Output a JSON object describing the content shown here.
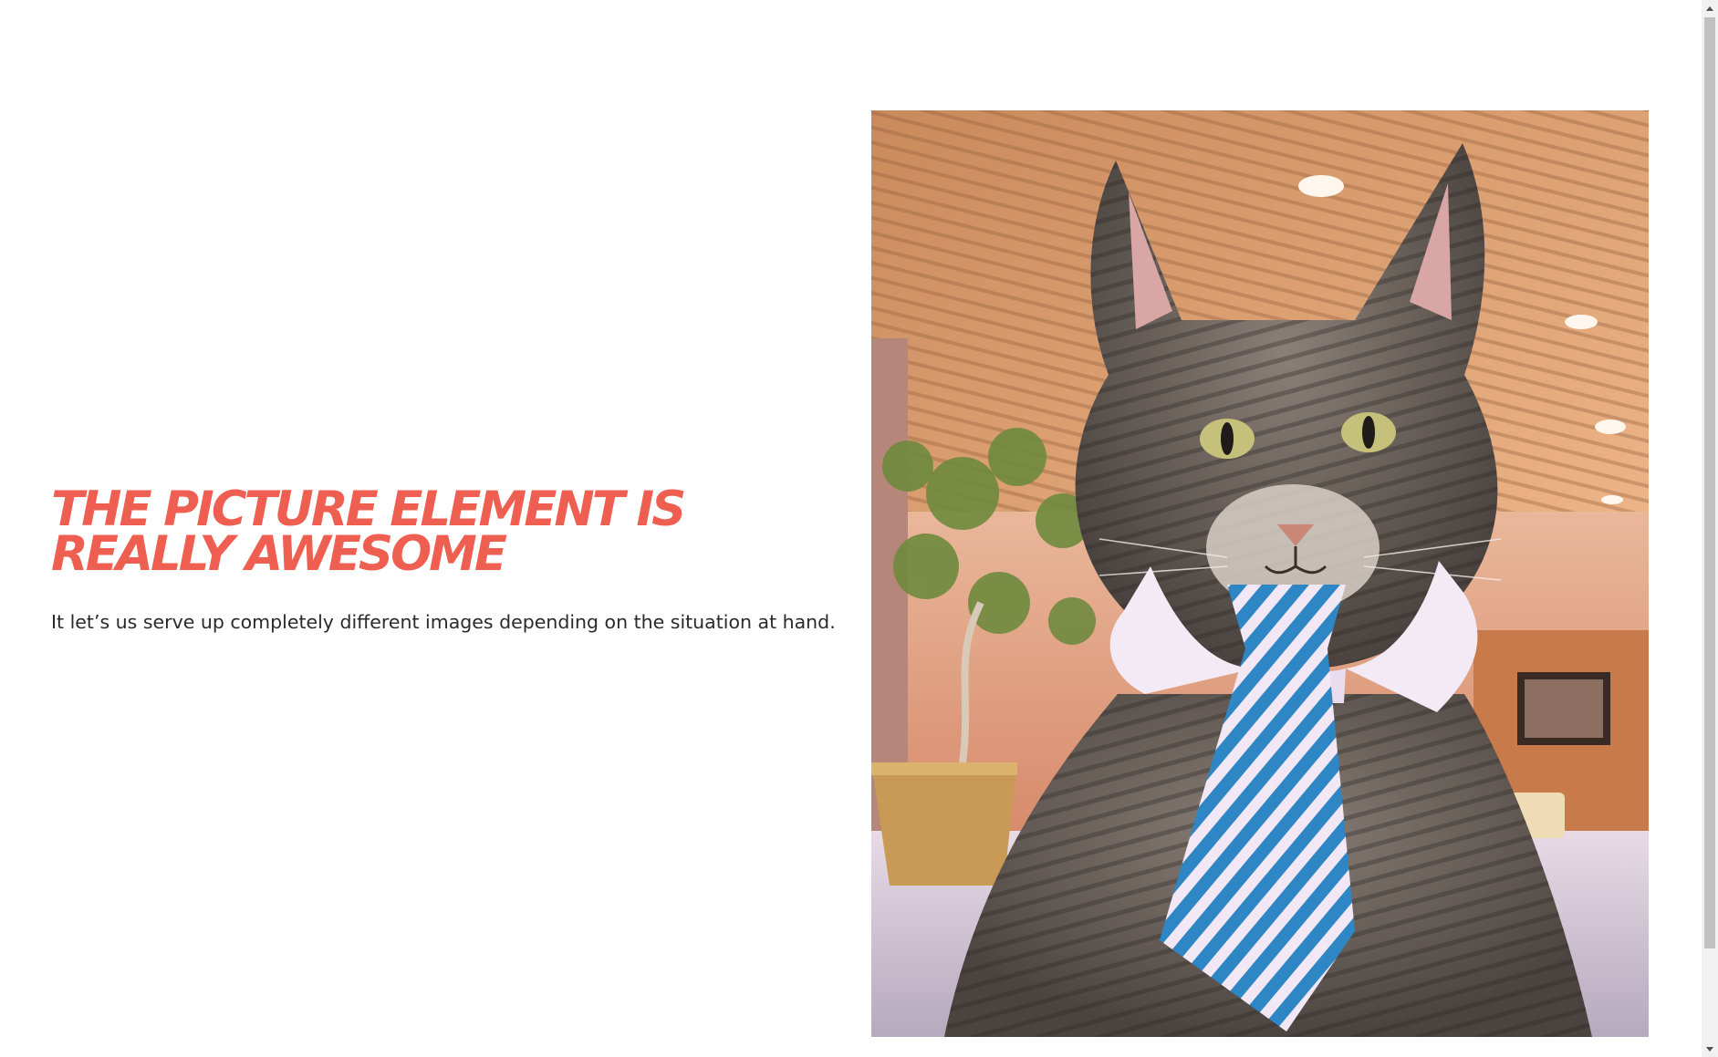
{
  "hero": {
    "heading": "The Picture Element Is Really Awesome",
    "body": "It let’s us serve up completely different images depending on the situation at hand."
  },
  "image": {
    "alt_semantic": "cat-wearing-collar-and-striped-tie"
  },
  "colors": {
    "heading": "#ef5f51",
    "body_text": "#2a2a2a",
    "background": "#ffffff",
    "tie_blue": "#2f86c4",
    "tie_stripe": "#f2e8f5"
  },
  "icons": {
    "scroll_up": "triangle-up-icon",
    "scroll_down": "triangle-down-icon"
  }
}
